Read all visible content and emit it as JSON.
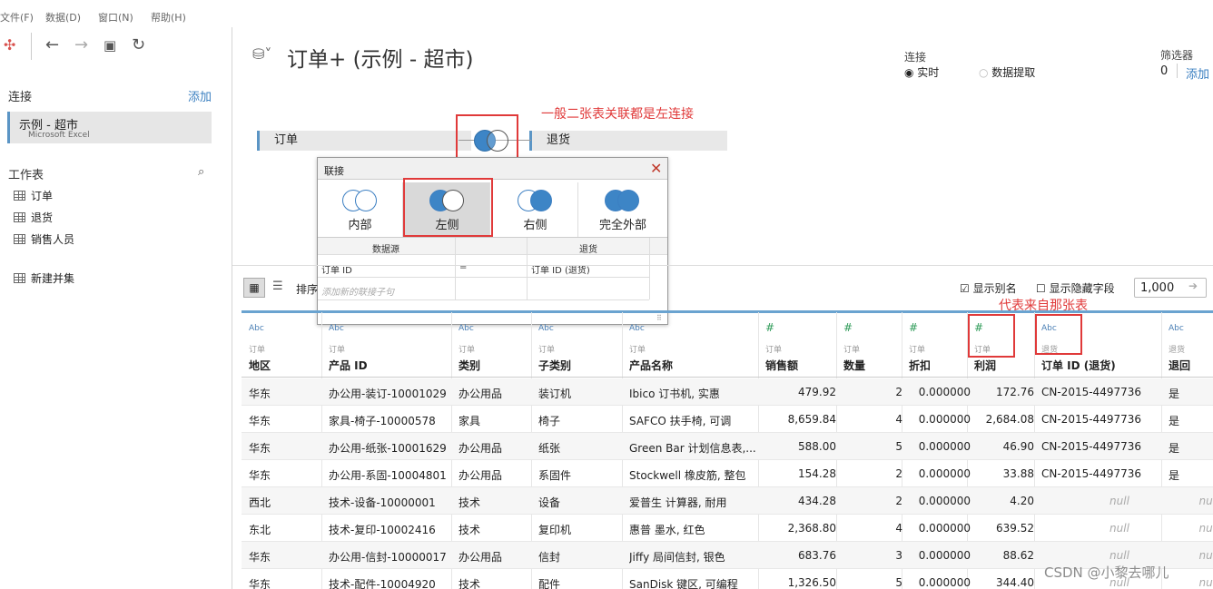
{
  "menu": [
    "文件(F)",
    "数据(D)",
    "窗口(N)",
    "帮助(H)"
  ],
  "sidebar": {
    "connections_label": "连接",
    "add_label": "添加",
    "connection_name": "示例 - 超市",
    "connection_type": "Microsoft Excel",
    "sheets_label": "工作表",
    "sheets": [
      "订单",
      "退货",
      "销售人员"
    ],
    "new_union": "新建并集"
  },
  "header": {
    "title": "订单+ (示例 - 超市)",
    "connection_label": "连接",
    "live_label": "实时",
    "extract_label": "数据提取",
    "filters_label": "筛选器",
    "filters_count": "0",
    "filters_add": "添加"
  },
  "join": {
    "left_table": "订单",
    "right_table": "退货",
    "annotation": "一般二张表关联都是左连接"
  },
  "dialog": {
    "title": "联接",
    "options": [
      "内部",
      "左侧",
      "右侧",
      "完全外部"
    ],
    "selected": "左侧",
    "col_left": "数据源",
    "col_right": "退货",
    "clause_left": "订单 ID",
    "clause_op": "=",
    "clause_right": "订单 ID (退货)",
    "add_clause": "添加新的联接子句"
  },
  "grid_toolbar": {
    "sort_label": "排序",
    "show_alias": "显示别名",
    "show_hidden": "显示隐藏字段",
    "rows_value": "1,000",
    "annotation": "代表来自那张表"
  },
  "columns": [
    {
      "type": "Abc",
      "source": "订单",
      "name": "地区"
    },
    {
      "type": "Abc",
      "source": "订单",
      "name": "产品 ID"
    },
    {
      "type": "Abc",
      "source": "订单",
      "name": "类别"
    },
    {
      "type": "Abc",
      "source": "订单",
      "name": "子类别"
    },
    {
      "type": "Abc",
      "source": "订单",
      "name": "产品名称"
    },
    {
      "type": "#",
      "source": "订单",
      "name": "销售额"
    },
    {
      "type": "#",
      "source": "订单",
      "name": "数量"
    },
    {
      "type": "#",
      "source": "订单",
      "name": "折扣"
    },
    {
      "type": "#",
      "source": "订单",
      "name": "利润"
    },
    {
      "type": "Abc",
      "source": "退货",
      "name": "订单 ID (退货)"
    },
    {
      "type": "Abc",
      "source": "退货",
      "name": "退回"
    }
  ],
  "rows": [
    [
      "华东",
      "办公用-装订-10001029",
      "办公用品",
      "装订机",
      "Ibico 订书机, 实惠",
      "479.92",
      "2",
      "0.000000",
      "172.76",
      "CN-2015-4497736",
      "是"
    ],
    [
      "华东",
      "家具-椅子-10000578",
      "家具",
      "椅子",
      "SAFCO 扶手椅, 可调",
      "8,659.84",
      "4",
      "0.000000",
      "2,684.08",
      "CN-2015-4497736",
      "是"
    ],
    [
      "华东",
      "办公用-纸张-10001629",
      "办公用品",
      "纸张",
      "Green Bar 计划信息表,...",
      "588.00",
      "5",
      "0.000000",
      "46.90",
      "CN-2015-4497736",
      "是"
    ],
    [
      "华东",
      "办公用-系固-10004801",
      "办公用品",
      "系固件",
      "Stockwell 橡皮筋, 整包",
      "154.28",
      "2",
      "0.000000",
      "33.88",
      "CN-2015-4497736",
      "是"
    ],
    [
      "西北",
      "技术-设备-10000001",
      "技术",
      "设备",
      "爱普生 计算器, 耐用",
      "434.28",
      "2",
      "0.000000",
      "4.20",
      "null",
      "null"
    ],
    [
      "东北",
      "技术-复印-10002416",
      "技术",
      "复印机",
      "惠普 墨水, 红色",
      "2,368.80",
      "4",
      "0.000000",
      "639.52",
      "null",
      "null"
    ],
    [
      "华东",
      "办公用-信封-10000017",
      "办公用品",
      "信封",
      "Jiffy 局间信封, 银色",
      "683.76",
      "3",
      "0.000000",
      "88.62",
      "null",
      "null"
    ],
    [
      "华东",
      "技术-配件-10004920",
      "技术",
      "配件",
      "SanDisk 键区, 可编程",
      "1,326.50",
      "5",
      "0.000000",
      "344.40",
      "null",
      "null"
    ]
  ],
  "watermark": "CSDN @小黎去哪儿"
}
